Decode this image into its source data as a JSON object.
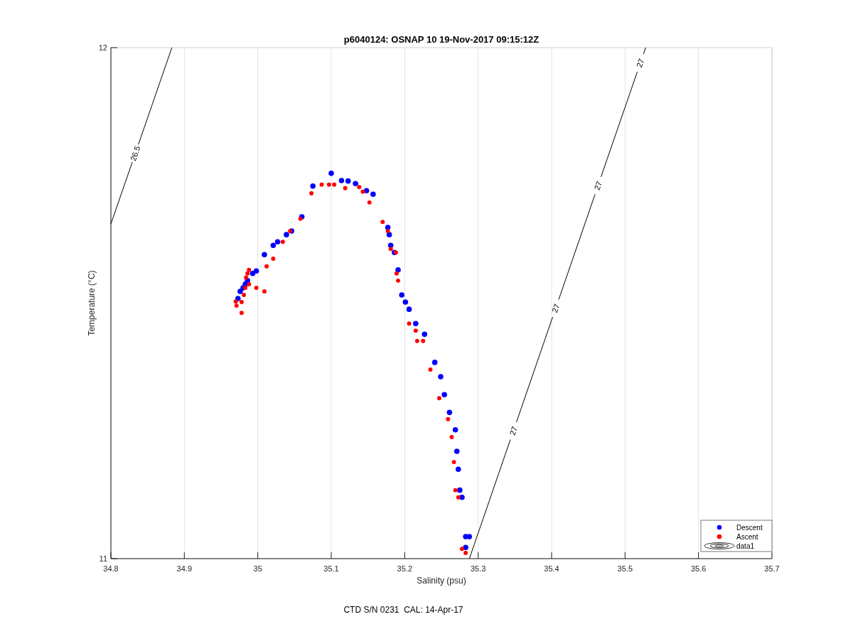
{
  "figure": {
    "footer": "CTD S/N 0231  CAL: 14-Apr-17"
  },
  "plot": {
    "chart_data": {
      "type": "scatter",
      "title": "p6040124: OSNAP 10 19-Nov-2017 09:15:12Z",
      "xlabel": "Salinity (psu)",
      "ylabel": "Temperature (°C)",
      "xlim": [
        34.8,
        35.7
      ],
      "ylim": [
        11,
        12
      ],
      "xticks": [
        {
          "value": 34.8,
          "label": "34.8"
        },
        {
          "value": 34.9,
          "label": "34.9"
        },
        {
          "value": 35,
          "label": "35"
        },
        {
          "value": 35.1,
          "label": "35.1"
        },
        {
          "value": 35.2,
          "label": "35.2"
        },
        {
          "value": 35.3,
          "label": "35.3"
        },
        {
          "value": 35.4,
          "label": "35.4"
        },
        {
          "value": 35.5,
          "label": "35.5"
        },
        {
          "value": 35.6,
          "label": "35.6"
        },
        {
          "value": 35.7,
          "label": "35.7"
        }
      ],
      "yticks": [
        {
          "value": 11,
          "label": "11"
        },
        {
          "value": 12,
          "label": "12"
        }
      ],
      "grid": true,
      "legend": "lower right",
      "series": [
        {
          "name": "Descent",
          "color": "#0000ff",
          "x": [
            34.973,
            34.976,
            34.98,
            34.983,
            34.986,
            34.993,
            34.998,
            35.009,
            35.021,
            35.027,
            35.039,
            35.046,
            35.06,
            35.075,
            35.1,
            35.114,
            35.123,
            35.133,
            35.148,
            35.157,
            35.177,
            35.179,
            35.181,
            35.186,
            35.191,
            35.196,
            35.201,
            35.206,
            35.215,
            35.227,
            35.241,
            35.249,
            35.254,
            35.261,
            35.269,
            35.271,
            35.273,
            35.275,
            35.278,
            35.283,
            35.288,
            35.283
          ],
          "values": [
            11.509,
            11.523,
            11.53,
            11.537,
            11.544,
            11.558,
            11.563,
            11.595,
            11.613,
            11.62,
            11.634,
            11.641,
            11.669,
            11.729,
            11.754,
            11.74,
            11.739,
            11.734,
            11.72,
            11.713,
            11.648,
            11.634,
            11.613,
            11.599,
            11.565,
            11.516,
            11.502,
            11.488,
            11.46,
            11.439,
            11.384,
            11.356,
            11.321,
            11.286,
            11.252,
            11.21,
            11.175,
            11.134,
            11.12,
            11.043,
            11.043,
            11.022
          ]
        },
        {
          "name": "Ascent",
          "color": "#ff0000",
          "x": [
            34.971,
            34.97,
            34.978,
            34.978,
            34.981,
            34.983,
            34.984,
            34.986,
            34.988,
            34.988,
            34.998,
            35.009,
            35.012,
            35.021,
            35.034,
            35.044,
            35.058,
            35.073,
            35.087,
            35.097,
            35.104,
            35.119,
            35.138,
            35.143,
            35.152,
            35.17,
            35.177,
            35.181,
            35.188,
            35.189,
            35.191,
            35.206,
            35.215,
            35.217,
            35.225,
            35.235,
            35.247,
            35.259,
            35.264,
            35.267,
            35.269,
            35.273,
            35.278,
            35.283
          ],
          "values": [
            11.495,
            11.503,
            11.502,
            11.481,
            11.516,
            11.53,
            11.55,
            11.558,
            11.565,
            11.537,
            11.53,
            11.523,
            11.572,
            11.587,
            11.62,
            11.641,
            11.665,
            11.715,
            11.732,
            11.732,
            11.732,
            11.725,
            11.727,
            11.718,
            11.697,
            11.659,
            11.641,
            11.606,
            11.599,
            11.558,
            11.544,
            11.46,
            11.446,
            11.426,
            11.426,
            11.37,
            11.314,
            11.273,
            11.238,
            11.189,
            11.134,
            11.12,
            11.019,
            11.011
          ]
        }
      ]
    },
    "contours": [
      {
        "labels": [
          "26.5"
        ]
      },
      {
        "labels": [
          "27",
          "27",
          "27",
          "27"
        ]
      }
    ],
    "legend": {
      "contour_label": "data1"
    }
  }
}
